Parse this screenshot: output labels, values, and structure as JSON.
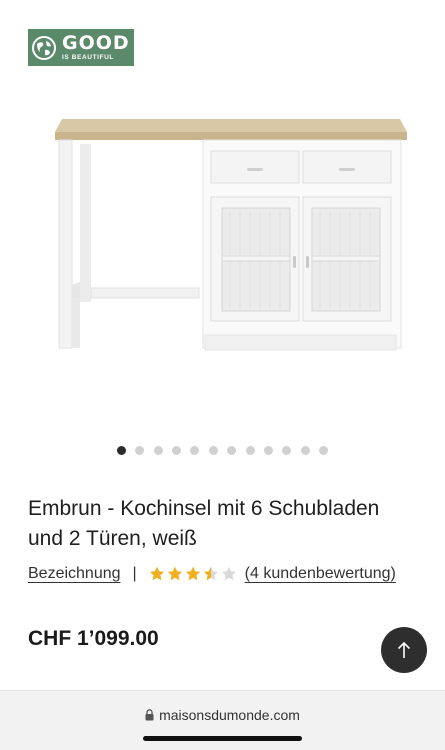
{
  "brand_badge": {
    "line1": "GOOD",
    "line2": "IS BEAUTIFUL",
    "icon": "globe-icon",
    "color": "#5b8a6b"
  },
  "product": {
    "image_alt": "white kitchen island with oak top, 2 drawers and 2 glass doors",
    "title": "Embrun - Kochinsel mit 6 Schubladen und 2 Türen, weiß",
    "description_link": "Bezeichnung",
    "separator": "|",
    "rating": 3.5,
    "rating_max": 5,
    "reviews_link": "(4 kundenbewertung)",
    "price": "CHF 1’099.00"
  },
  "carousel": {
    "count": 12,
    "active_index": 0
  },
  "back_to_top": {
    "icon": "arrow-up-icon"
  },
  "browser": {
    "url": "maisonsdumonde.com",
    "lock_icon": "lock-icon"
  },
  "colors": {
    "star": "#f2b01e",
    "star_empty": "#d9d9d9",
    "dark": "#2e2e2e"
  }
}
